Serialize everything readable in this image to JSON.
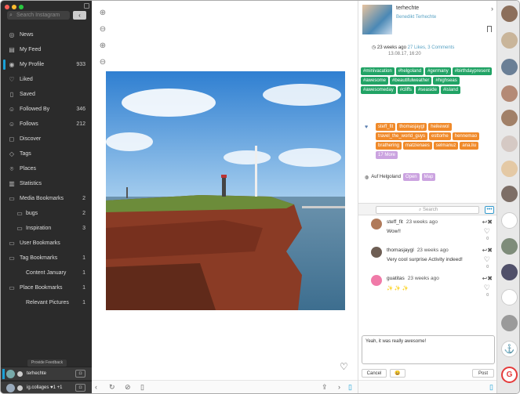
{
  "sidebar": {
    "search_placeholder": "Search Instagram",
    "nav": [
      {
        "label": "News",
        "icon": "news-icon",
        "glyph": "◎"
      },
      {
        "label": "My Feed",
        "icon": "feed-icon",
        "glyph": "▤"
      },
      {
        "label": "My Profile",
        "icon": "profile-icon",
        "glyph": "◉",
        "count": "933",
        "active": true
      },
      {
        "label": "Liked",
        "icon": "heart-icon",
        "glyph": "♡"
      },
      {
        "label": "Saved",
        "icon": "bookmark-icon",
        "glyph": "▯"
      },
      {
        "label": "Followed By",
        "icon": "followers-icon",
        "glyph": "☺",
        "count": "346"
      },
      {
        "label": "Follows",
        "icon": "follows-icon",
        "glyph": "☺",
        "count": "212"
      },
      {
        "label": "Discover",
        "icon": "discover-icon",
        "glyph": "◻"
      },
      {
        "label": "Tags",
        "icon": "tag-icon",
        "glyph": "◇"
      },
      {
        "label": "Places",
        "icon": "location-pin-icon",
        "glyph": "⌾"
      },
      {
        "label": "Statistics",
        "icon": "statistics-icon",
        "glyph": "▥"
      },
      {
        "label": "Media Bookmarks",
        "icon": "folder-icon",
        "glyph": "▭",
        "count": "2"
      },
      {
        "label": "bugs",
        "icon": "folder-icon",
        "glyph": "▭",
        "count": "2",
        "sub": true
      },
      {
        "label": "Inspiration",
        "icon": "folder-icon",
        "glyph": "▭",
        "count": "3",
        "sub": true
      },
      {
        "label": "User Bookmarks",
        "icon": "folder-icon",
        "glyph": "▭"
      },
      {
        "label": "Tag Bookmarks",
        "icon": "folder-icon",
        "glyph": "▭",
        "count": "1"
      },
      {
        "label": "Content January",
        "icon": "folder-icon",
        "glyph": "",
        "count": "1",
        "sub": true
      },
      {
        "label": "Place Bookmarks",
        "icon": "folder-icon",
        "glyph": "▭",
        "count": "1"
      },
      {
        "label": "Relevant Pictures",
        "icon": "folder-icon",
        "glyph": "",
        "count": "1",
        "sub": true
      }
    ],
    "feedback": "Provide Feedback",
    "accounts": [
      {
        "name": "terhechte"
      },
      {
        "name": "ig.collages ♥1 +1"
      }
    ]
  },
  "post": {
    "username": "terhechte",
    "fullname": "Benedikt Terhechte",
    "ago": "23 weeks ago",
    "likes_comments": "27 Likes, 3 Comments",
    "date": "13.08.17, 16:20",
    "tags": [
      "#minivacation",
      "#helgoland",
      "#germany",
      "#birthdaypresent",
      "#awesome",
      "#beautifulweather",
      "#highseas",
      "#awesomeday",
      "#cliffs",
      "#seaside",
      "#island"
    ],
    "users": [
      "steff_fit",
      "thomasjaygl",
      "heikewol",
      "travel_the_world_guys",
      "esttorhe",
      "hennemao",
      "brathering",
      "matzienaes",
      "selmanuz",
      "ana.liu"
    ],
    "more": "17 More",
    "location": "Auf Helgoland",
    "open": "Open",
    "map": "Map"
  },
  "comments": {
    "search_placeholder": "Search",
    "items": [
      {
        "user": "steff_fit",
        "ago": "23 weeks ago",
        "text": "Wow!!",
        "zero": "0"
      },
      {
        "user": "thomasjaygl",
        "ago": "23 weeks ago",
        "text": "Very cool surprise Activity indeed!",
        "zero": "0"
      },
      {
        "user": "guatitas",
        "ago": "23 weeks ago",
        "text": "✨ ✨ ✨",
        "zero": "0"
      }
    ],
    "reply": "Yeah, it was really awesome!",
    "cancel": "Cancel",
    "emoji": "😀",
    "post": "Post"
  },
  "colors": {
    "sidebar": "#2b2b2b",
    "accent": "#1aa0d6",
    "tag": "#21a365",
    "user": "#f08a2a",
    "pill": "#cba3e0"
  }
}
